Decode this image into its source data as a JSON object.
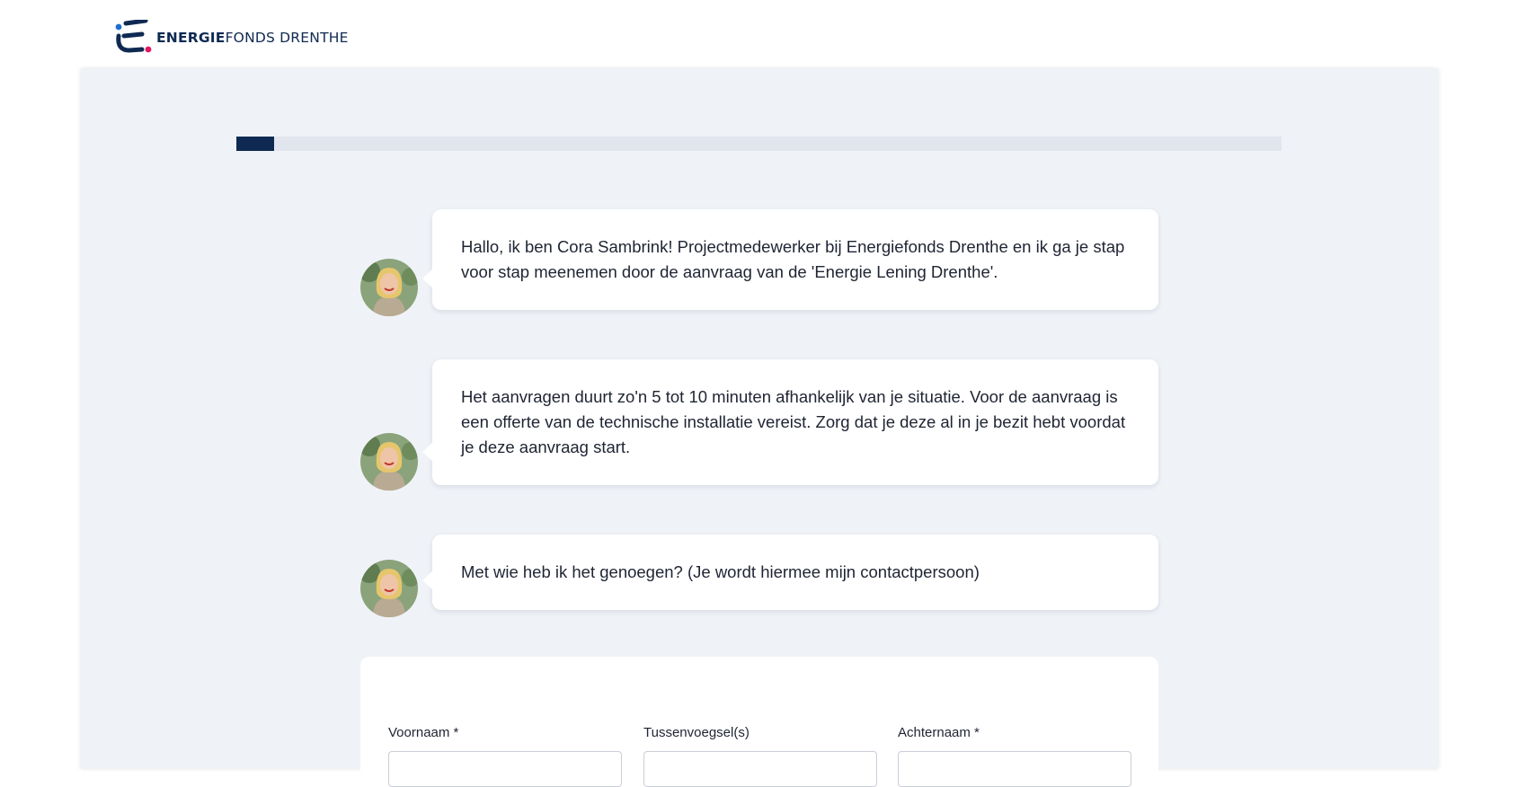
{
  "header": {
    "logo_bold": "ENERGIE",
    "logo_rest": "FONDS DRENTHE",
    "brand_colors": {
      "navy": "#0f2a52",
      "blue": "#1f6fd1",
      "pink": "#e0185f"
    }
  },
  "progress": {
    "fraction": 0.036
  },
  "chat": {
    "avatar_icon": "person-avatar",
    "messages": [
      {
        "text": "Hallo, ik ben Cora Sambrink! Projectmedewerker bij Energiefonds Drenthe en ik ga je stap voor stap meenemen door de aanvraag van de 'Energie Lening Drenthe'."
      },
      {
        "text": "Het aanvragen duurt zo'n 5 tot 10 minuten afhankelijk van je situatie. Voor de aanvraag is een offerte van de technische installatie vereist. Zorg dat je deze al in je bezit hebt voordat je deze aanvraag start."
      },
      {
        "text": "Met wie heb ik het genoegen? (Je wordt hiermee mijn contactpersoon)"
      }
    ]
  },
  "form": {
    "fields": [
      {
        "label": "Voornaam *",
        "value": ""
      },
      {
        "label": "Tussenvoegsel(s)",
        "value": ""
      },
      {
        "label": "Achternaam *",
        "value": ""
      }
    ]
  }
}
